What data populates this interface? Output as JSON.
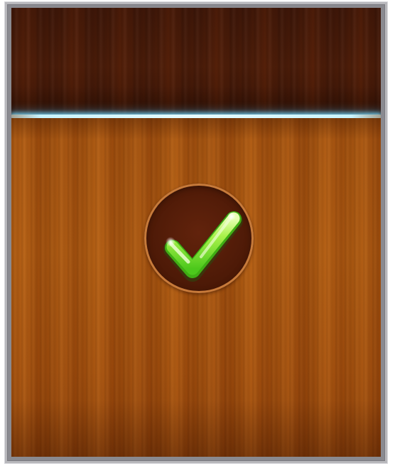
{
  "screen": {
    "name": "level-complete-panel"
  },
  "confirm_button": {
    "icon": "checkmark-icon",
    "icon_color": "#6fe02a",
    "ring_color": "#c77a3a"
  },
  "colors": {
    "frame": "#b8b8bc",
    "top_panel": "#4a1c09",
    "main_panel": "#aa5810",
    "light_bar": "#c8f4ff"
  }
}
